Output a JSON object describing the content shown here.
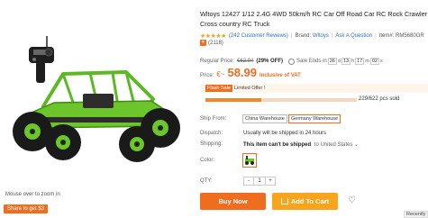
{
  "image": {
    "hint": "Mouse over to zoom in",
    "share": "Share to get $3"
  },
  "product": {
    "title": "Wltoys 12427 1/12 2.4G 4WD 50km/h RC Car Off Road Car RC Rock Crawler Cross country RC Truck",
    "stars": "★★★★★",
    "reviews_link": "(242 Customer Reviews)",
    "brand_label": "Brand:",
    "brand_value": "Wltoys",
    "ask_link": "Ask A Question",
    "item_no": "Item#: RM5680GR",
    "favorites": "(2118)"
  },
  "pricing": {
    "regular_label": "Regular Price:",
    "regular_value": "€62.94",
    "off": "(29% OFF)",
    "sale_label": "Sale Ends in",
    "timer": [
      "26",
      "d",
      "13",
      "h",
      "17",
      "m",
      "02",
      "s"
    ],
    "price_label": "Price:",
    "currency": "€~",
    "price_value": "58.99",
    "vat": "Inclusive of VAT"
  },
  "flash": {
    "tag": "Flash Sale",
    "limit": "Limited Offer !",
    "sold": "229/622 pcs sold",
    "progress": 0.368
  },
  "options": {
    "ship_from_label": "Ship From:",
    "warehouses": [
      "China Warehouse",
      "Germany Warehouse"
    ],
    "selected_warehouse": "Germany Warehouse",
    "dispatch_label": "Dispatch:",
    "dispatch_value": "Usually will be shipped in 24 hours",
    "shipping_label": "Shipping:",
    "shipping_value": "This item can't be shipped",
    "ship_to": "to United States ⌄",
    "color_label": "Color:",
    "qty_label": "QTY:",
    "qty_minus": "-",
    "qty_value": "1",
    "qty_plus": "+"
  },
  "actions": {
    "buy": "Buy Now",
    "cart": "Add To Cart",
    "wishlist": "♡",
    "recently": "Recently"
  },
  "colors": {
    "accent": "#ef6d1f",
    "cart": "#f8a41c",
    "car_green": "#6cc52a"
  }
}
